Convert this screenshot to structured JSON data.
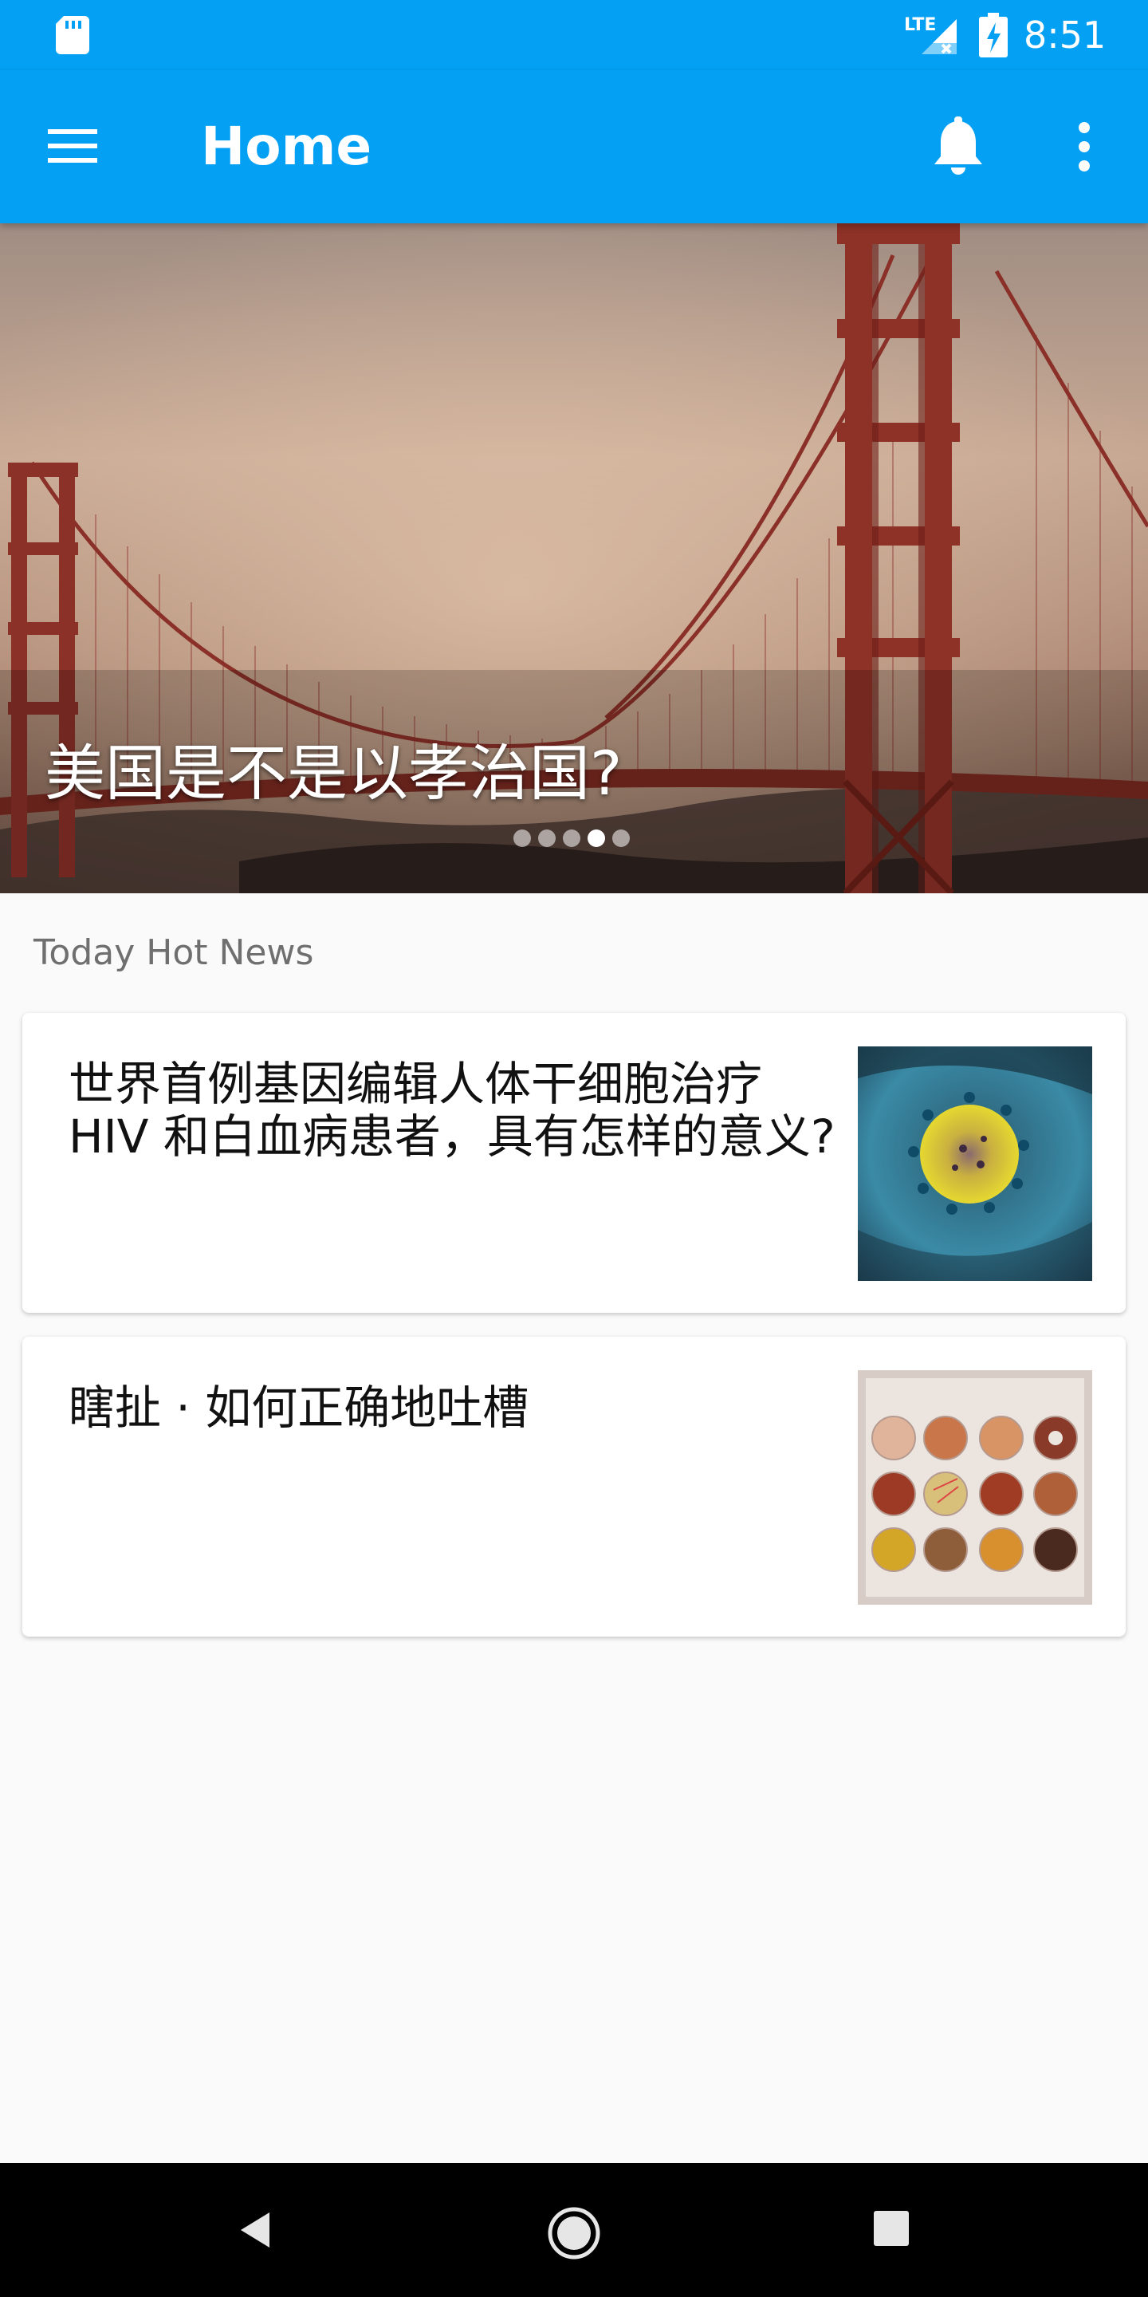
{
  "status_bar": {
    "time": "8:51",
    "network_label": "LTE",
    "icons": [
      "sd-card-icon",
      "signal-icon",
      "battery-charging-icon"
    ]
  },
  "app_bar": {
    "title": "Home",
    "icons": [
      "menu-icon",
      "bell-icon",
      "overflow-icon"
    ]
  },
  "hero": {
    "title": "美国是不是以孝治国?",
    "page_count": 5,
    "active_page": 4
  },
  "news": {
    "section_title": "Today Hot News",
    "items": [
      {
        "title": "世界首例基因编辑人体干细胞治疗 HIV 和白血病患者，具有怎样的意义?",
        "thumbnail": "virus-image"
      },
      {
        "title": "瞎扯 · 如何正确地吐槽",
        "thumbnail": "eyeshadow-palette-image"
      }
    ]
  },
  "colors": {
    "primary": "#03a0f3",
    "background": "#fafafa",
    "nav_bar": "#000000"
  }
}
